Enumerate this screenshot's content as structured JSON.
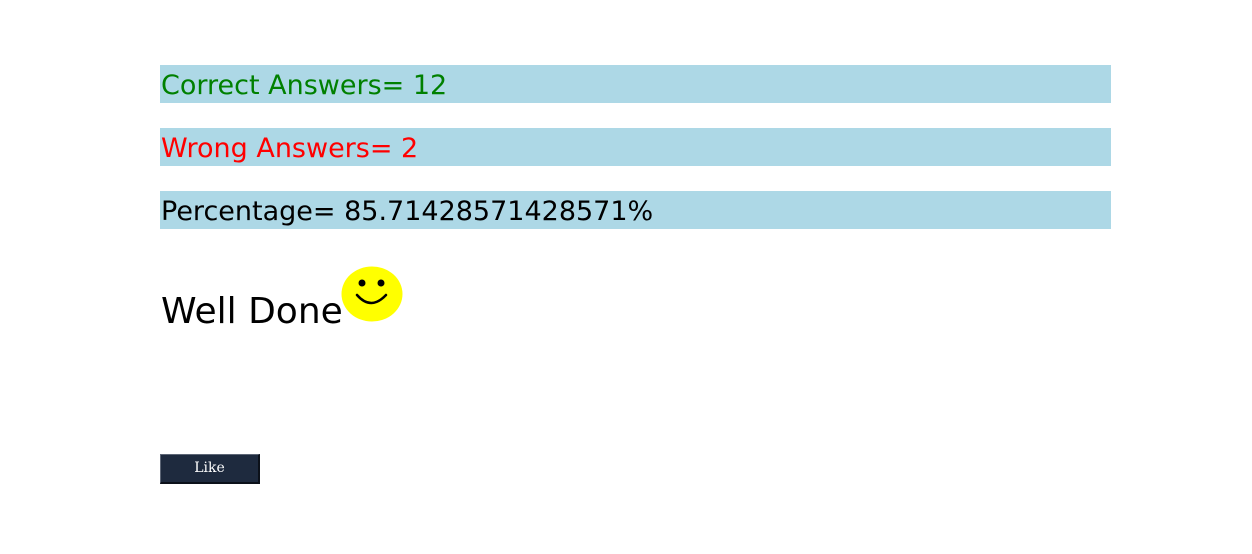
{
  "results": {
    "correct": {
      "label": "Correct Answers= 12",
      "color": "#008000"
    },
    "wrong": {
      "label": "Wrong Answers= 2",
      "color": "#ff0000"
    },
    "percentage": {
      "label": "Percentage= 85.71428571428571%",
      "color": "#000000"
    },
    "bar_color": "#add8e6"
  },
  "feedback": {
    "message": "Well Done",
    "icon": "smiley-face-icon",
    "icon_color": "#ffff00"
  },
  "like_button": {
    "label": "Like",
    "background": "#1e2a3e"
  }
}
